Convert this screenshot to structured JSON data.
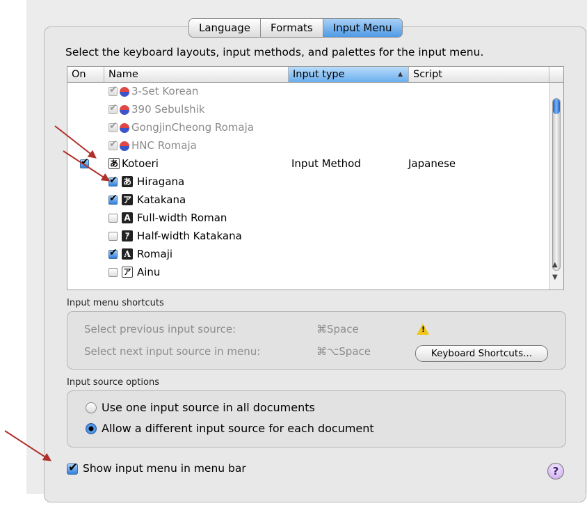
{
  "tabs": [
    {
      "label": "Language",
      "selected": false
    },
    {
      "label": "Formats",
      "selected": false
    },
    {
      "label": "Input Menu",
      "selected": true
    }
  ],
  "instruction": "Select the keyboard layouts, input methods, and palettes for the input menu.",
  "table": {
    "columns": {
      "on": "On",
      "name": "Name",
      "type": "Input type",
      "script": "Script"
    },
    "rows": [
      {
        "checked": true,
        "dimmed": true,
        "name": "3-Set Korean",
        "type": "",
        "script": ""
      },
      {
        "checked": true,
        "dimmed": true,
        "name": "390 Sebulshik",
        "type": "",
        "script": ""
      },
      {
        "checked": true,
        "dimmed": true,
        "name": "GongjinCheong Romaja",
        "type": "",
        "script": ""
      },
      {
        "checked": true,
        "dimmed": true,
        "name": "HNC Romaja",
        "type": "",
        "script": ""
      },
      {
        "checked": true,
        "dimmed": false,
        "name": "Kotoeri",
        "type": "Input Method",
        "script": "Japanese"
      },
      {
        "checked": true,
        "dimmed": false,
        "name": "Hiragana",
        "type": "",
        "script": ""
      },
      {
        "checked": true,
        "dimmed": false,
        "name": "Katakana",
        "type": "",
        "script": ""
      },
      {
        "checked": false,
        "dimmed": false,
        "name": "Full-width Roman",
        "type": "",
        "script": ""
      },
      {
        "checked": false,
        "dimmed": false,
        "name": "Half-width Katakana",
        "type": "",
        "script": ""
      },
      {
        "checked": true,
        "dimmed": false,
        "name": "Romaji",
        "type": "",
        "script": ""
      },
      {
        "checked": false,
        "dimmed": false,
        "name": "Ainu",
        "type": "",
        "script": ""
      }
    ]
  },
  "shortcuts": {
    "title": "Input menu shortcuts",
    "prev_label": "Select previous input source:",
    "prev_key": "⌘Space",
    "next_label": "Select next input source in menu:",
    "next_key": "⌘⌥Space",
    "button": "Keyboard Shortcuts..."
  },
  "options": {
    "title": "Input source options",
    "one": "Use one input source in all documents",
    "each": "Allow a different input source for each document",
    "selected": "each"
  },
  "show_menu": {
    "label": "Show input menu in menu bar",
    "checked": true
  },
  "help": "?"
}
